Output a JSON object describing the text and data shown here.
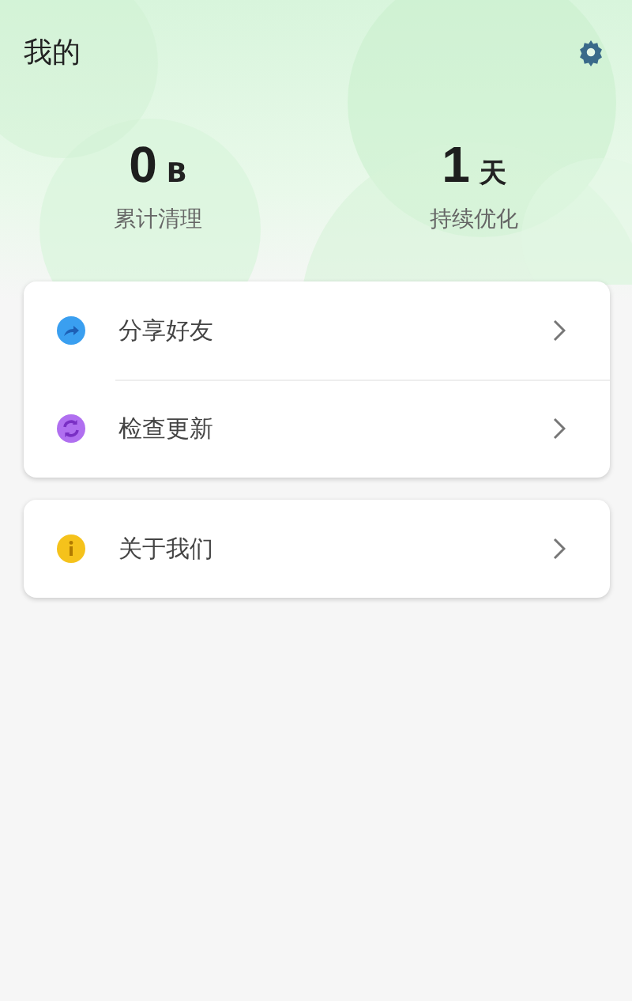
{
  "header": {
    "title": "我的"
  },
  "stats": [
    {
      "value": "0",
      "unit": "B",
      "label": "累计清理"
    },
    {
      "value": "1",
      "unit": "天",
      "label": "持续优化"
    }
  ],
  "groups": [
    {
      "items": [
        {
          "kind": "share",
          "label": "分享好友"
        },
        {
          "kind": "update",
          "label": "检查更新"
        }
      ]
    },
    {
      "items": [
        {
          "kind": "info",
          "label": "关于我们"
        }
      ]
    }
  ]
}
